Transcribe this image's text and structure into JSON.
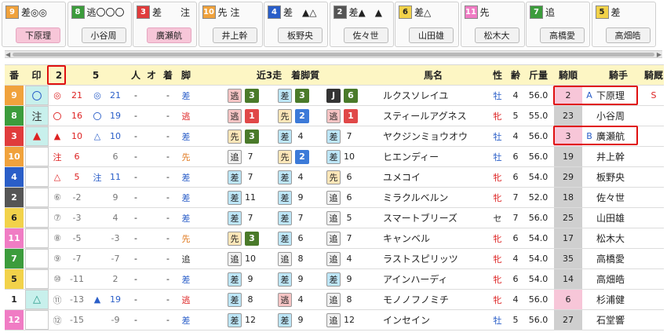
{
  "cards": [
    {
      "num": "9",
      "num_color": "#f0a23c",
      "text": "差◎◎",
      "jockey": "下原理",
      "pink": true
    },
    {
      "num": "8",
      "num_color": "#3c9c3c",
      "text": "逃〇〇〇",
      "jockey": "小谷周",
      "pink": false
    },
    {
      "num": "3",
      "num_color": "#e03c3c",
      "text": "差　　注",
      "jockey": "廣瀬航",
      "pink": true
    },
    {
      "num": "10",
      "num_color": "#f0a23c",
      "text": "先 注",
      "jockey": "井上幹",
      "pink": false
    },
    {
      "num": "4",
      "num_color": "#2a5ec8",
      "text": "差　▲△",
      "jockey": "板野央",
      "pink": false
    },
    {
      "num": "2",
      "num_color": "#555555",
      "text": "差▲　▲",
      "jockey": "佐々世",
      "pink": false
    },
    {
      "num": "6",
      "num_color": "#f2d24a",
      "text": "差△",
      "jockey": "山田雄",
      "pink": false
    },
    {
      "num": "11",
      "num_color": "#f07cc4",
      "text": "先",
      "jockey": "松木大",
      "pink": false
    },
    {
      "num": "7",
      "num_color": "#3c9c3c",
      "text": "追",
      "jockey": "高橋愛",
      "pink": false
    },
    {
      "num": "5",
      "num_color": "#f2d24a",
      "text": "差",
      "jockey": "高畑皓",
      "pink": false
    }
  ],
  "headers": {
    "ban": "番",
    "shirushi": "印",
    "col2": "2",
    "col5": "5",
    "h1": "人",
    "h2": "オ",
    "h3": "着",
    "kyaku": "脚",
    "kin3": "近3走　着脚質",
    "umamei": "馬名",
    "sei": "性",
    "rei": "齢",
    "kinryo": "斤量",
    "kijun": "騎順",
    "kishu": "騎手",
    "kyusha": "騎厩"
  },
  "rows": [
    {
      "ban": "9",
      "ban_color": "#f0a23c",
      "mark": "〇",
      "m2": "◎",
      "v2": "21",
      "m5": "◎",
      "v5": "21",
      "a": "-",
      "b": "-",
      "kyaku": "差",
      "r1s": "逃",
      "r1n": "3",
      "r2s": "差",
      "r2n": "3",
      "r3s": "J",
      "r3n": "6",
      "name": "ルクスソレイユ",
      "sei": "牡",
      "rei": "4",
      "kin": "56.0",
      "kijun": "2",
      "pink": true,
      "grade": "A",
      "jockey": "下原理",
      "extra": "S"
    },
    {
      "ban": "8",
      "ban_color": "#3c9c3c",
      "mark": "注",
      "m2": "〇",
      "v2": "16",
      "m5": "〇",
      "v5": "19",
      "a": "-",
      "b": "-",
      "kyaku": "逃",
      "r1s": "逃",
      "r1n": "1",
      "r2s": "先",
      "r2n": "2",
      "r3s": "逃",
      "r3n": "1",
      "name": "スティールアグネス",
      "sei": "牝",
      "rei": "5",
      "kin": "55.0",
      "kijun": "23",
      "pink": false,
      "grade": "",
      "jockey": "小谷周",
      "extra": ""
    },
    {
      "ban": "3",
      "ban_color": "#e03c3c",
      "mark": "▲",
      "m2": "▲",
      "v2": "10",
      "m5": "△",
      "v5": "10",
      "a": "-",
      "b": "-",
      "kyaku": "差",
      "r1s": "先",
      "r1n": "3",
      "r2s": "差",
      "r2n": "4",
      "r3s": "差",
      "r3n": "7",
      "name": "ヤクジンミョウオウ",
      "sei": "牡",
      "rei": "4",
      "kin": "56.0",
      "kijun": "3",
      "pink": true,
      "grade": "B",
      "jockey": "廣瀬航",
      "extra": ""
    },
    {
      "ban": "10",
      "ban_color": "#f0a23c",
      "mark": "",
      "m2": "注",
      "v2": "6",
      "m5": "",
      "v5": "6",
      "a": "-",
      "b": "-",
      "kyaku": "先",
      "r1s": "追",
      "r1n": "7",
      "r2s": "先",
      "r2n": "2",
      "r3s": "差",
      "r3n": "10",
      "name": "ヒエンディー",
      "sei": "牡",
      "rei": "6",
      "kin": "56.0",
      "kijun": "19",
      "pink": false,
      "grade": "",
      "jockey": "井上幹",
      "extra": ""
    },
    {
      "ban": "4",
      "ban_color": "#2a5ec8",
      "mark": "",
      "m2": "△",
      "v2": "5",
      "m5": "注",
      "v5": "11",
      "a": "-",
      "b": "-",
      "kyaku": "差",
      "r1s": "差",
      "r1n": "7",
      "r2s": "差",
      "r2n": "4",
      "r3s": "先",
      "r3n": "6",
      "name": "ユメコイ",
      "sei": "牝",
      "rei": "6",
      "kin": "54.0",
      "kijun": "29",
      "pink": false,
      "grade": "",
      "jockey": "板野央",
      "extra": ""
    },
    {
      "ban": "2",
      "ban_color": "#555555",
      "mark": "",
      "m2": "⑥",
      "v2": "-2",
      "m5": "",
      "v5": "9",
      "a": "-",
      "b": "-",
      "kyaku": "差",
      "r1s": "差",
      "r1n": "11",
      "r2s": "差",
      "r2n": "9",
      "r3s": "追",
      "r3n": "6",
      "name": "ミラクルベルン",
      "sei": "牝",
      "rei": "7",
      "kin": "52.0",
      "kijun": "18",
      "pink": false,
      "grade": "",
      "jockey": "佐々世",
      "extra": ""
    },
    {
      "ban": "6",
      "ban_color": "#f2d24a",
      "mark": "",
      "m2": "⑦",
      "v2": "-3",
      "m5": "",
      "v5": "4",
      "a": "-",
      "b": "-",
      "kyaku": "差",
      "r1s": "差",
      "r1n": "7",
      "r2s": "差",
      "r2n": "7",
      "r3s": "追",
      "r3n": "5",
      "name": "スマートブリーズ",
      "sei": "セ",
      "rei": "7",
      "kin": "56.0",
      "kijun": "25",
      "pink": false,
      "grade": "",
      "jockey": "山田雄",
      "extra": ""
    },
    {
      "ban": "11",
      "ban_color": "#f07cc4",
      "mark": "",
      "m2": "⑧",
      "v2": "-5",
      "m5": "",
      "v5": "-3",
      "a": "-",
      "b": "-",
      "kyaku": "先",
      "r1s": "先",
      "r1n": "3",
      "r2s": "差",
      "r2n": "6",
      "r3s": "追",
      "r3n": "7",
      "name": "キャンベル",
      "sei": "牝",
      "rei": "6",
      "kin": "54.0",
      "kijun": "17",
      "pink": false,
      "grade": "",
      "jockey": "松木大",
      "extra": ""
    },
    {
      "ban": "7",
      "ban_color": "#3c9c3c",
      "mark": "",
      "m2": "⑨",
      "v2": "-7",
      "m5": "",
      "v5": "-7",
      "a": "-",
      "b": "-",
      "kyaku": "追",
      "r1s": "追",
      "r1n": "10",
      "r2s": "追",
      "r2n": "8",
      "r3s": "追",
      "r3n": "4",
      "name": "ラストスピリッツ",
      "sei": "牝",
      "rei": "4",
      "kin": "54.0",
      "kijun": "35",
      "pink": false,
      "grade": "",
      "jockey": "高橋愛",
      "extra": ""
    },
    {
      "ban": "5",
      "ban_color": "#f2d24a",
      "mark": "",
      "m2": "⑩",
      "v2": "-11",
      "m5": "",
      "v5": "2",
      "a": "-",
      "b": "-",
      "kyaku": "差",
      "r1s": "差",
      "r1n": "9",
      "r2s": "差",
      "r2n": "9",
      "r3s": "差",
      "r3n": "9",
      "name": "アインハーディ",
      "sei": "牝",
      "rei": "6",
      "kin": "54.0",
      "kijun": "14",
      "pink": false,
      "grade": "",
      "jockey": "高畑皓",
      "extra": ""
    },
    {
      "ban": "1",
      "ban_color": "#ffffff",
      "mark": "△",
      "m2": "⑪",
      "v2": "-13",
      "m5": "▲",
      "v5": "19",
      "a": "-",
      "b": "-",
      "kyaku": "逃",
      "r1s": "差",
      "r1n": "8",
      "r2s": "逃",
      "r2n": "4",
      "r3s": "追",
      "r3n": "8",
      "name": "モノノフノミチ",
      "sei": "牝",
      "rei": "4",
      "kin": "56.0",
      "kijun": "6",
      "pink": true,
      "grade": "",
      "jockey": "杉浦健",
      "extra": ""
    },
    {
      "ban": "12",
      "ban_color": "#f07cc4",
      "mark": "",
      "m2": "⑫",
      "v2": "-15",
      "m5": "",
      "v5": "-9",
      "a": "-",
      "b": "-",
      "kyaku": "差",
      "r1s": "差",
      "r1n": "12",
      "r2s": "差",
      "r2n": "9",
      "r3s": "追",
      "r3n": "12",
      "name": "インセイン",
      "sei": "牡",
      "rei": "5",
      "kin": "56.0",
      "kijun": "27",
      "pink": false,
      "grade": "",
      "jockey": "石堂響",
      "extra": ""
    }
  ]
}
